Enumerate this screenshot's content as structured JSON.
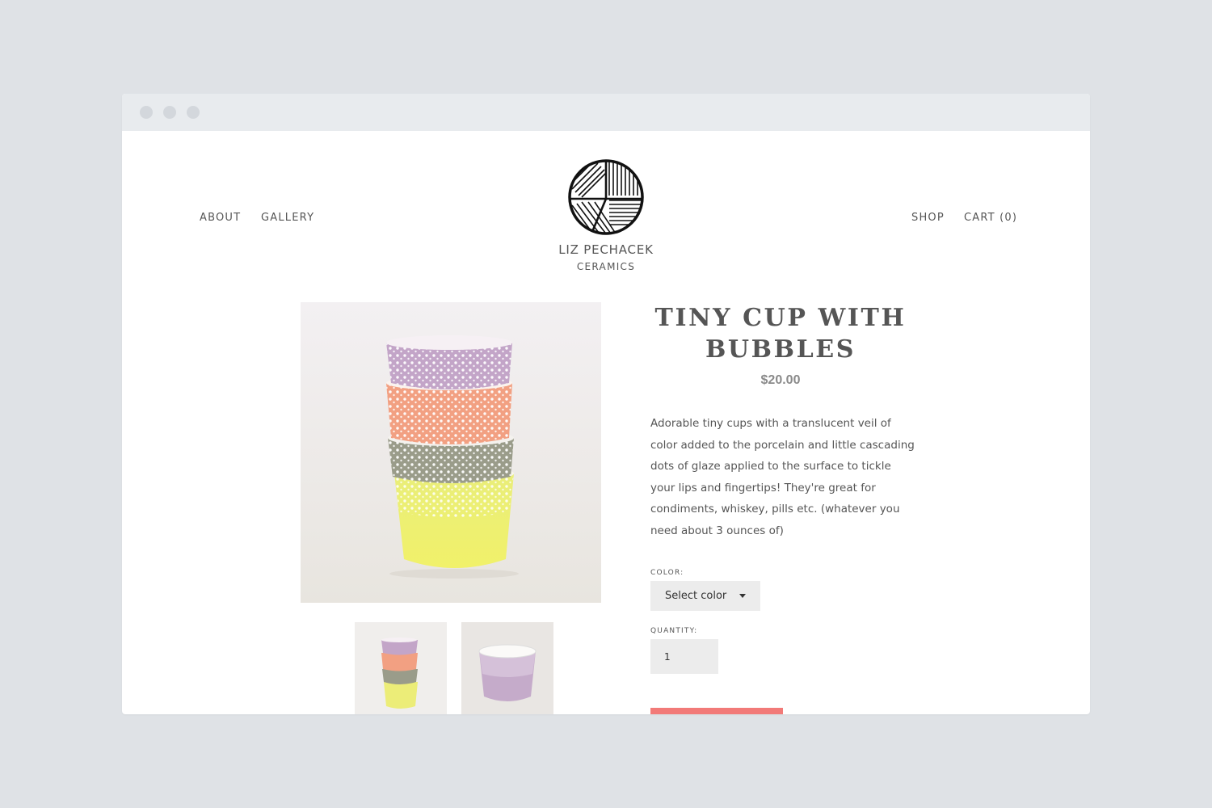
{
  "nav": {
    "about": "ABOUT",
    "gallery": "GALLERY",
    "shop": "SHOP",
    "cart": "CART (0)"
  },
  "brand": {
    "line1": "LIZ PECHACEK",
    "line2": "CERAMICS"
  },
  "product": {
    "title": "TINY CUP WITH BUBBLES",
    "price": "$20.00",
    "description": "Adorable tiny cups with a translucent veil of color added to the porcelain and little cascading dots of glaze applied to the surface to tickle your lips and fingertips!  They're great for condiments, whiskey, pills etc.  (whatever you need about 3 ounces of)"
  },
  "form": {
    "color_label": "COLOR:",
    "color_value": "Select color",
    "quantity_label": "QUANTITY:",
    "quantity_value": "1"
  },
  "colors": {
    "add_button": "#f27a78",
    "price": "#8a8a8a",
    "field_bg": "#ececec",
    "window_bar": "#e8ebee",
    "page_bg": "#dfe2e6"
  },
  "icons": {
    "logo": "woven-circle-logo",
    "select": "caret-down-icon"
  }
}
